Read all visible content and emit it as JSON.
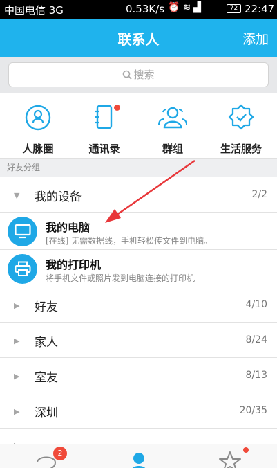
{
  "statusbar": {
    "carrier": "中国电信 3G",
    "speed": "0.53K/s",
    "battery": "72",
    "time": "22:47"
  },
  "navbar": {
    "title": "联系人",
    "add_label": "添加"
  },
  "search": {
    "placeholder": "搜索"
  },
  "quick_actions": [
    {
      "label": "人脉圈",
      "icon": "contact-circle-icon"
    },
    {
      "label": "通讯录",
      "icon": "address-book-icon",
      "badge": true
    },
    {
      "label": "群组",
      "icon": "group-icon"
    },
    {
      "label": "生活服务",
      "icon": "life-service-icon"
    }
  ],
  "section": {
    "title": "好友分组"
  },
  "groups": {
    "devices": {
      "name": "我的设备",
      "count": "2/2",
      "expanded": true
    },
    "friends": {
      "name": "好友",
      "count": "4/10"
    },
    "family": {
      "name": "家人",
      "count": "8/24"
    },
    "roommates": {
      "name": "室友",
      "count": "8/13"
    },
    "shenzhen": {
      "name": "深圳",
      "count": "20/35"
    }
  },
  "devices": [
    {
      "name": "我的电脑",
      "desc": "[在线] 无需数据线，手机轻松传文件到电脑。",
      "icon": "computer-icon"
    },
    {
      "name": "我的打印机",
      "desc": "将手机文件或照片发到电脑连接的打印机",
      "icon": "printer-icon"
    }
  ],
  "tabbar": {
    "messages_badge": "2"
  },
  "colors": {
    "accent": "#1fb3ed",
    "badge": "#f04a3a",
    "arrow": "#e8373a"
  }
}
